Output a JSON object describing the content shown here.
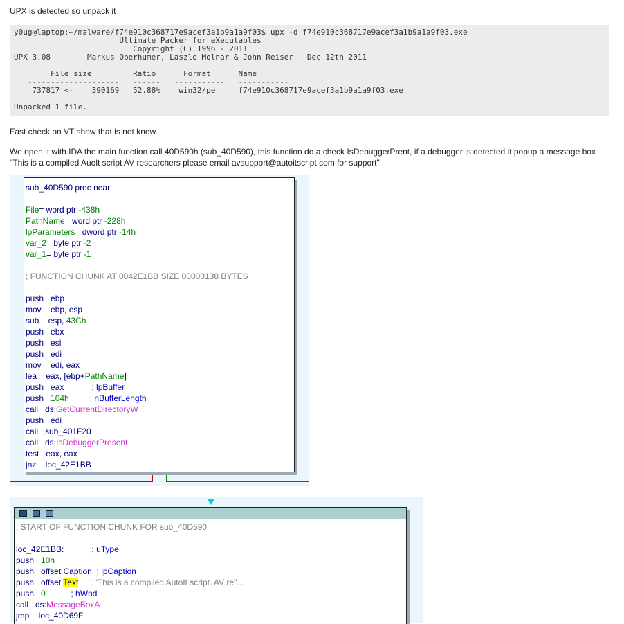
{
  "intro": "UPX is detected so unpack it",
  "terminal": {
    "lines": [
      "y0ug@laptop:~/malware/f74e910c368717e9acef3a1b9a1a9f03$ upx -d f74e910c368717e9acef3a1b9a1a9f03.exe",
      "                       Ultimate Packer for eXecutables",
      "                          Copyright (C) 1996 - 2011",
      "UPX 3.08        Markus Oberhumer, Laszlo Molnar & John Reiser   Dec 12th 2011",
      "",
      "        File size         Ratio      Format      Name",
      "   --------------------   ------   -----------   -----------",
      "    737817 <-    390169   52.88%    win32/pe     f74e910c368717e9acef3a1b9a1a9f03.exe"
    ],
    "footer": "Unpacked 1 file."
  },
  "vt_check": "Fast check on VT show that is not know.",
  "ida_description": "We open it with IDA the main function call 40D590h (sub_40D590), this function do a check IsDebuggerPrent, if a debugger is detected it popup a message box \"This is a compiled Auolt script AV researchers please email avsupport@autoitscript.com for support\"",
  "block1": {
    "proc": "sub_40D590 proc near",
    "vars": [
      {
        "name": "File",
        "rest": "= word ptr ",
        "val": "-438h"
      },
      {
        "name": "PathName",
        "rest": "= word ptr ",
        "val": "-228h"
      },
      {
        "name": "lpParameters",
        "rest": "= dword ptr ",
        "val": "-14h"
      },
      {
        "name": "var_2",
        "rest": "= byte ptr ",
        "val": "-2"
      },
      {
        "name": "var_1",
        "rest": "= byte ptr ",
        "val": "-1"
      }
    ],
    "chunk": "; FUNCTION CHUNK AT 0042E1BB SIZE 00000138 BYTES",
    "l1": "push   ebp",
    "l2": "mov    ebp, esp",
    "l3a": "sub    esp, ",
    "l3b": "43Ch",
    "l4": "push   ebx",
    "l5": "push   esi",
    "l6": "push   edi",
    "l7": "mov    edi, eax",
    "l8a": "lea    eax, [ebp+",
    "l8b": "PathName",
    "l8c": "]",
    "l9a": "push   eax",
    "l9b": "            ; lpBuffer",
    "l10a": "push   ",
    "l10b": "104h",
    "l10c": "         ; nBufferLength",
    "l11a": "call   ds:",
    "l11b": "GetCurrentDirectoryW",
    "l12": "push   edi",
    "l13": "call   sub_401F20",
    "l14a": "call   ds:",
    "l14b": "IsDebuggerPresent",
    "l15": "test   eax, eax",
    "l16": "jnz    loc_42E1BB"
  },
  "block2": {
    "chunk_start": "; START OF FUNCTION CHUNK FOR sub_40D590",
    "l1a": "loc_42E1BB:",
    "l1b": "            ; uType",
    "l2a": "push   ",
    "l2b": "10h",
    "l3a": "push   offset Caption",
    "l3b": "  ; lpCaption",
    "l4a": "push   offset ",
    "l4b": "Text",
    "l4c": "     ; \"This is a compiled AutoIt script. AV re\"...",
    "l5a": "push   ",
    "l5b": "0",
    "l5c": "           ; hWnd",
    "l6a": "call   ds:",
    "l6b": "MessageBoxA",
    "l7": "jmp    loc_40D69F"
  },
  "colors": {
    "ida_background": "#eaf6fb",
    "titlebar": "#a9cfcf",
    "false_edge": "#cc0000",
    "true_edge": "#008000"
  }
}
